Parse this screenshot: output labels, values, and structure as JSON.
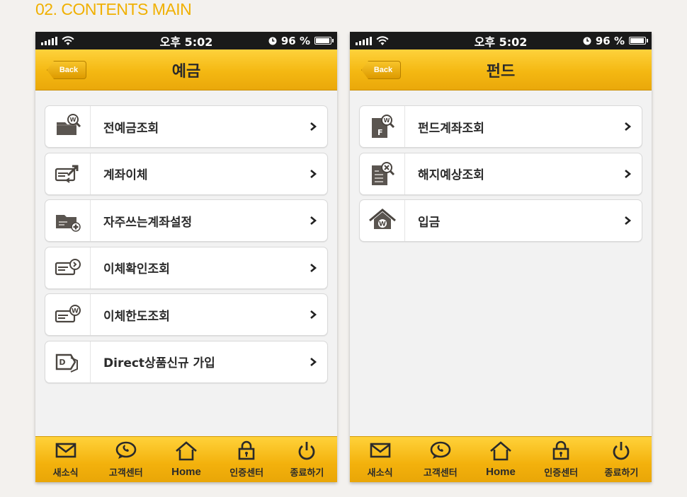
{
  "section_title": "02. CONTENTS MAIN",
  "status": {
    "carrier_time": "오후 5:02",
    "battery": "96 %",
    "battery_level": 0.96
  },
  "back_label": "Back",
  "left": {
    "title": "예금",
    "items": [
      {
        "label": "전예금조회",
        "icon": "folder-won-search-icon"
      },
      {
        "label": "계좌이체",
        "icon": "card-transfer-icon"
      },
      {
        "label": "자주쓰는계좌설정",
        "icon": "folder-add-icon"
      },
      {
        "label": "이체확인조회",
        "icon": "card-check-icon"
      },
      {
        "label": "이체한도조회",
        "icon": "card-won-icon"
      },
      {
        "label": "Direct상품신규 가입",
        "icon": "direct-product-icon"
      }
    ]
  },
  "right": {
    "title": "펀드",
    "items": [
      {
        "label": "펀드계좌조회",
        "icon": "fund-search-icon"
      },
      {
        "label": "해지예상조회",
        "icon": "cancel-search-icon"
      },
      {
        "label": "입금",
        "icon": "house-won-icon"
      }
    ]
  },
  "tabs": [
    {
      "label": "새소식",
      "icon": "mail-icon"
    },
    {
      "label": "고객센터",
      "icon": "chat-icon"
    },
    {
      "label": "Home",
      "icon": "home-icon"
    },
    {
      "label": "인증센터",
      "icon": "lock-icon"
    },
    {
      "label": "종료하기",
      "icon": "power-icon"
    }
  ],
  "colors": {
    "accent": "#f4b812",
    "title_orange": "#f0b000",
    "status_bg": "#1a1a1a"
  }
}
